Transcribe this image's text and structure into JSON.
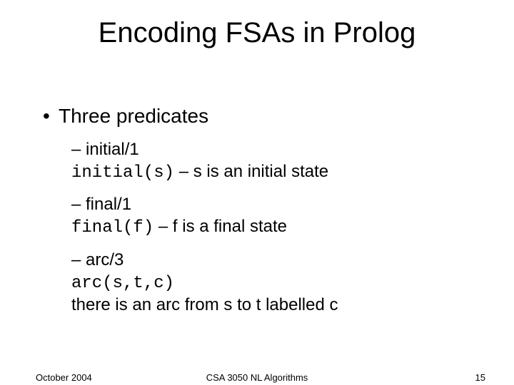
{
  "title": "Encoding FSAs in Prolog",
  "bullet1": "Three predicates",
  "items": [
    {
      "head": "initial/1",
      "code": "initial(s)",
      "desc": " – s is an initial state"
    },
    {
      "head": "final/1",
      "code": "final(f)",
      "desc": " – f is a final state"
    },
    {
      "head": "arc/3",
      "code": "arc(s,t,c)",
      "desc_line2": "there is an arc from s to t labelled c"
    }
  ],
  "footer": {
    "left": "October 2004",
    "center": "CSA 3050 NL Algorithms",
    "right": "15"
  }
}
